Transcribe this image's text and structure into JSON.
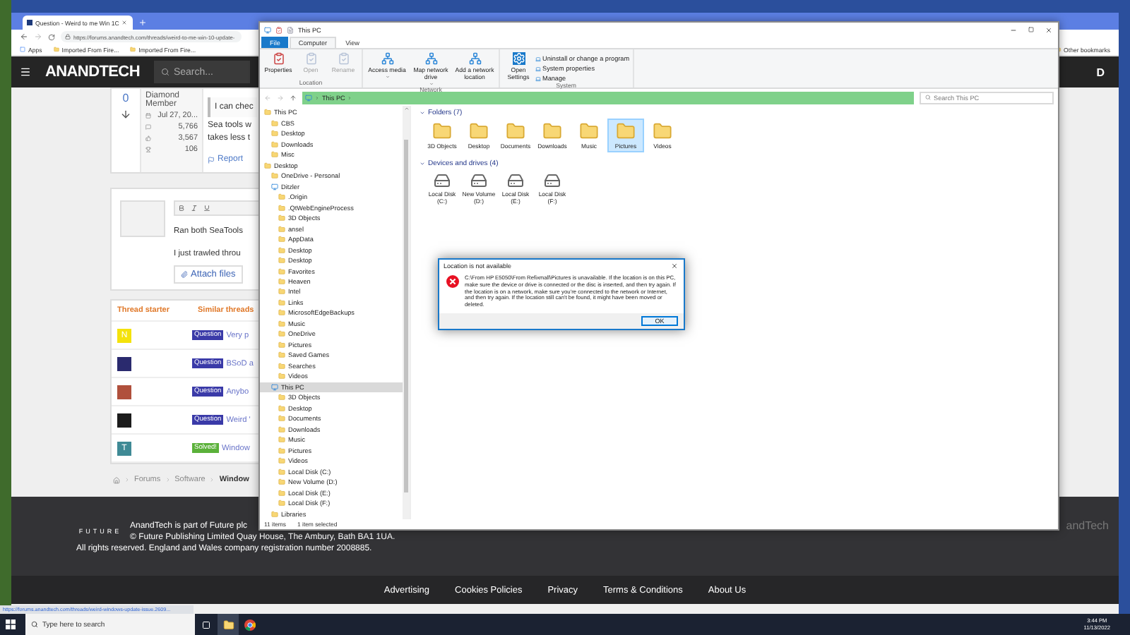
{
  "browser": {
    "tab_title": "Question - Weird to me Win 1C",
    "url": "https://forums.anandtech.com/threads/weird-to-me-win-10-update-",
    "bookmarks": [
      "Apps",
      "Imported From Fire...",
      "Imported From Fire..."
    ],
    "other_bookmarks": "Other bookmarks"
  },
  "site_header": {
    "logo": "ANANDTECH",
    "search": {
      "placeholder": "Search..."
    },
    "account_initial": "D"
  },
  "post": {
    "votes": "0",
    "member_title": "Diamond Member",
    "joined": "Jul 27, 20...",
    "stats": [
      "5,766",
      "3,567",
      "106"
    ],
    "quote": "I can chec",
    "body": [
      "Sea tools w",
      "takes less t"
    ],
    "report": "Report"
  },
  "reply": {
    "editor_lines": [
      "Ran both SeaTools",
      "I just trawled throu"
    ],
    "attach": "Attach files"
  },
  "similar": {
    "columns": [
      "Thread starter",
      "Similar threads"
    ],
    "rows": [
      {
        "avatar": "N",
        "color": "#f4e20c",
        "prefix": {
          "kind": "question",
          "label": "Question"
        },
        "title": "Very p"
      },
      {
        "color": "#2a2a6e",
        "prefix": {
          "kind": "question",
          "label": "Question"
        },
        "title": "BSoD a"
      },
      {
        "color": "#b0503c",
        "prefix": {
          "kind": "question",
          "label": "Question"
        },
        "title": "Anybo"
      },
      {
        "color": "#1c1c1c",
        "prefix": {
          "kind": "question",
          "label": "Question"
        },
        "title": "Weird '"
      },
      {
        "avatar": "T",
        "color": "#3f8a95",
        "prefix": {
          "kind": "solved",
          "label": "Solved!"
        },
        "title": "Window"
      }
    ]
  },
  "breadcrumb": [
    "Forums",
    "Software",
    "Window"
  ],
  "footer": {
    "logo": "FUTURE",
    "lines": [
      "AnandTech is part of Future plc",
      "© Future Publishing Limited Quay House, The Ambury, Bath BA1 1UA.",
      "All rights reserved. England and Wales company registration number 2008885."
    ],
    "brand_right": "andTech",
    "links": [
      "Advertising",
      "Cookies Policies",
      "Privacy",
      "Terms & Conditions",
      "About Us"
    ]
  },
  "status_url": "https://forums.anandtech.com/threads/weird-windows-update-issue.2609...",
  "explorer": {
    "title": "This PC",
    "ribbon_tabs": [
      {
        "label": "File",
        "kind": "file",
        "selected": false
      },
      {
        "label": "Computer",
        "kind": "tab",
        "selected": true
      },
      {
        "label": "View",
        "kind": "tab",
        "selected": false
      }
    ],
    "ribbon_groups": [
      {
        "name": "Location",
        "buttons": [
          {
            "label": "Properties",
            "disabled": false,
            "dropdown": false
          },
          {
            "label": "Open",
            "disabled": true,
            "dropdown": false
          },
          {
            "label": "Rename",
            "disabled": true,
            "dropdown": false
          }
        ]
      },
      {
        "name": "Network",
        "buttons": [
          {
            "label": "Access media",
            "disabled": false,
            "dropdown": true
          },
          {
            "label": "Map network drive",
            "disabled": false,
            "dropdown": true
          },
          {
            "label": "Add a network location",
            "disabled": false,
            "dropdown": false
          }
        ]
      },
      {
        "name": "System",
        "buttons": [
          {
            "label": "Open Settings",
            "disabled": false,
            "dropdown": false
          }
        ],
        "small_buttons": [
          "Uninstall or change a program",
          "System properties",
          "Manage"
        ]
      }
    ],
    "address": "This PC",
    "search": {
      "placeholder": "Search This PC"
    },
    "nav": [
      {
        "label": "This PC",
        "selected": false,
        "children": [
          {
            "label": "CBS",
            "selected": false
          },
          {
            "label": "Desktop",
            "selected": false
          },
          {
            "label": "Downloads",
            "selected": false
          },
          {
            "label": "Misc",
            "selected": false
          }
        ]
      },
      {
        "label": "Desktop",
        "selected": false,
        "children": [
          {
            "label": "OneDrive - Personal",
            "selected": false
          },
          {
            "label": "Ditzler",
            "selected": false,
            "children": [
              {
                "label": ".Origin",
                "selected": false
              },
              {
                "label": ".QtWebEngineProcess",
                "selected": false
              },
              {
                "label": "3D Objects",
                "selected": false
              },
              {
                "label": "ansel",
                "selected": false
              },
              {
                "label": "AppData",
                "selected": false
              },
              {
                "label": "Desktop",
                "selected": false
              },
              {
                "label": "Desktop",
                "selected": false
              },
              {
                "label": "Favorites",
                "selected": false
              },
              {
                "label": "Heaven",
                "selected": false
              },
              {
                "label": "Intel",
                "selected": false
              },
              {
                "label": "Links",
                "selected": false
              },
              {
                "label": "MicrosoftEdgeBackups",
                "selected": false
              },
              {
                "label": "Music",
                "selected": false
              },
              {
                "label": "OneDrive",
                "selected": false
              },
              {
                "label": "Pictures",
                "selected": false
              },
              {
                "label": "Saved Games",
                "selected": false
              },
              {
                "label": "Searches",
                "selected": false
              },
              {
                "label": "Videos",
                "selected": false
              }
            ]
          },
          {
            "label": "This PC",
            "selected": true,
            "children": [
              {
                "label": "3D Objects",
                "selected": false
              },
              {
                "label": "Desktop",
                "selected": false
              },
              {
                "label": "Documents",
                "selected": false
              },
              {
                "label": "Downloads",
                "selected": false
              },
              {
                "label": "Music",
                "selected": false
              },
              {
                "label": "Pictures",
                "selected": false
              },
              {
                "label": "Videos",
                "selected": false
              },
              {
                "label": "Local Disk (C:)",
                "selected": false
              },
              {
                "label": "New Volume (D:)",
                "selected": false
              },
              {
                "label": "Local Disk (E:)",
                "selected": false
              },
              {
                "label": "Local Disk (F:)",
                "selected": false
              }
            ]
          },
          {
            "label": "Libraries",
            "selected": false
          }
        ]
      }
    ],
    "sections": [
      {
        "title": "Folders (7)",
        "kind": "folders",
        "items": [
          {
            "label": "3D Objects",
            "selected": false
          },
          {
            "label": "Desktop",
            "selected": false
          },
          {
            "label": "Documents",
            "selected": false
          },
          {
            "label": "Downloads",
            "selected": false
          },
          {
            "label": "Music",
            "selected": false
          },
          {
            "label": "Pictures",
            "selected": true
          },
          {
            "label": "Videos",
            "selected": false
          }
        ]
      },
      {
        "title": "Devices and drives (4)",
        "kind": "drives",
        "items": [
          {
            "label": "Local Disk (C:)",
            "selected": false
          },
          {
            "label": "New Volume (D:)",
            "selected": false
          },
          {
            "label": "Local Disk (E:)",
            "selected": false
          },
          {
            "label": "Local Disk (F:)",
            "selected": false
          }
        ]
      }
    ],
    "status": [
      "11 items",
      "1 item selected"
    ]
  },
  "dialog": {
    "title": "Location is not available",
    "message": "C:\\From HP E5050\\From Refixmall\\Pictures is unavailable. If the location is on this PC, make sure the device or drive is connected or the disc is inserted, and then try again. If the location is on a network, make sure you're connected to the network or Internet, and then try again. If the location still can't be found, it might have been moved or deleted.",
    "button": "OK"
  },
  "taskbar": {
    "search": {
      "placeholder": "Type here to search"
    },
    "time": "3:44 PM",
    "date": "11/13/2022"
  }
}
